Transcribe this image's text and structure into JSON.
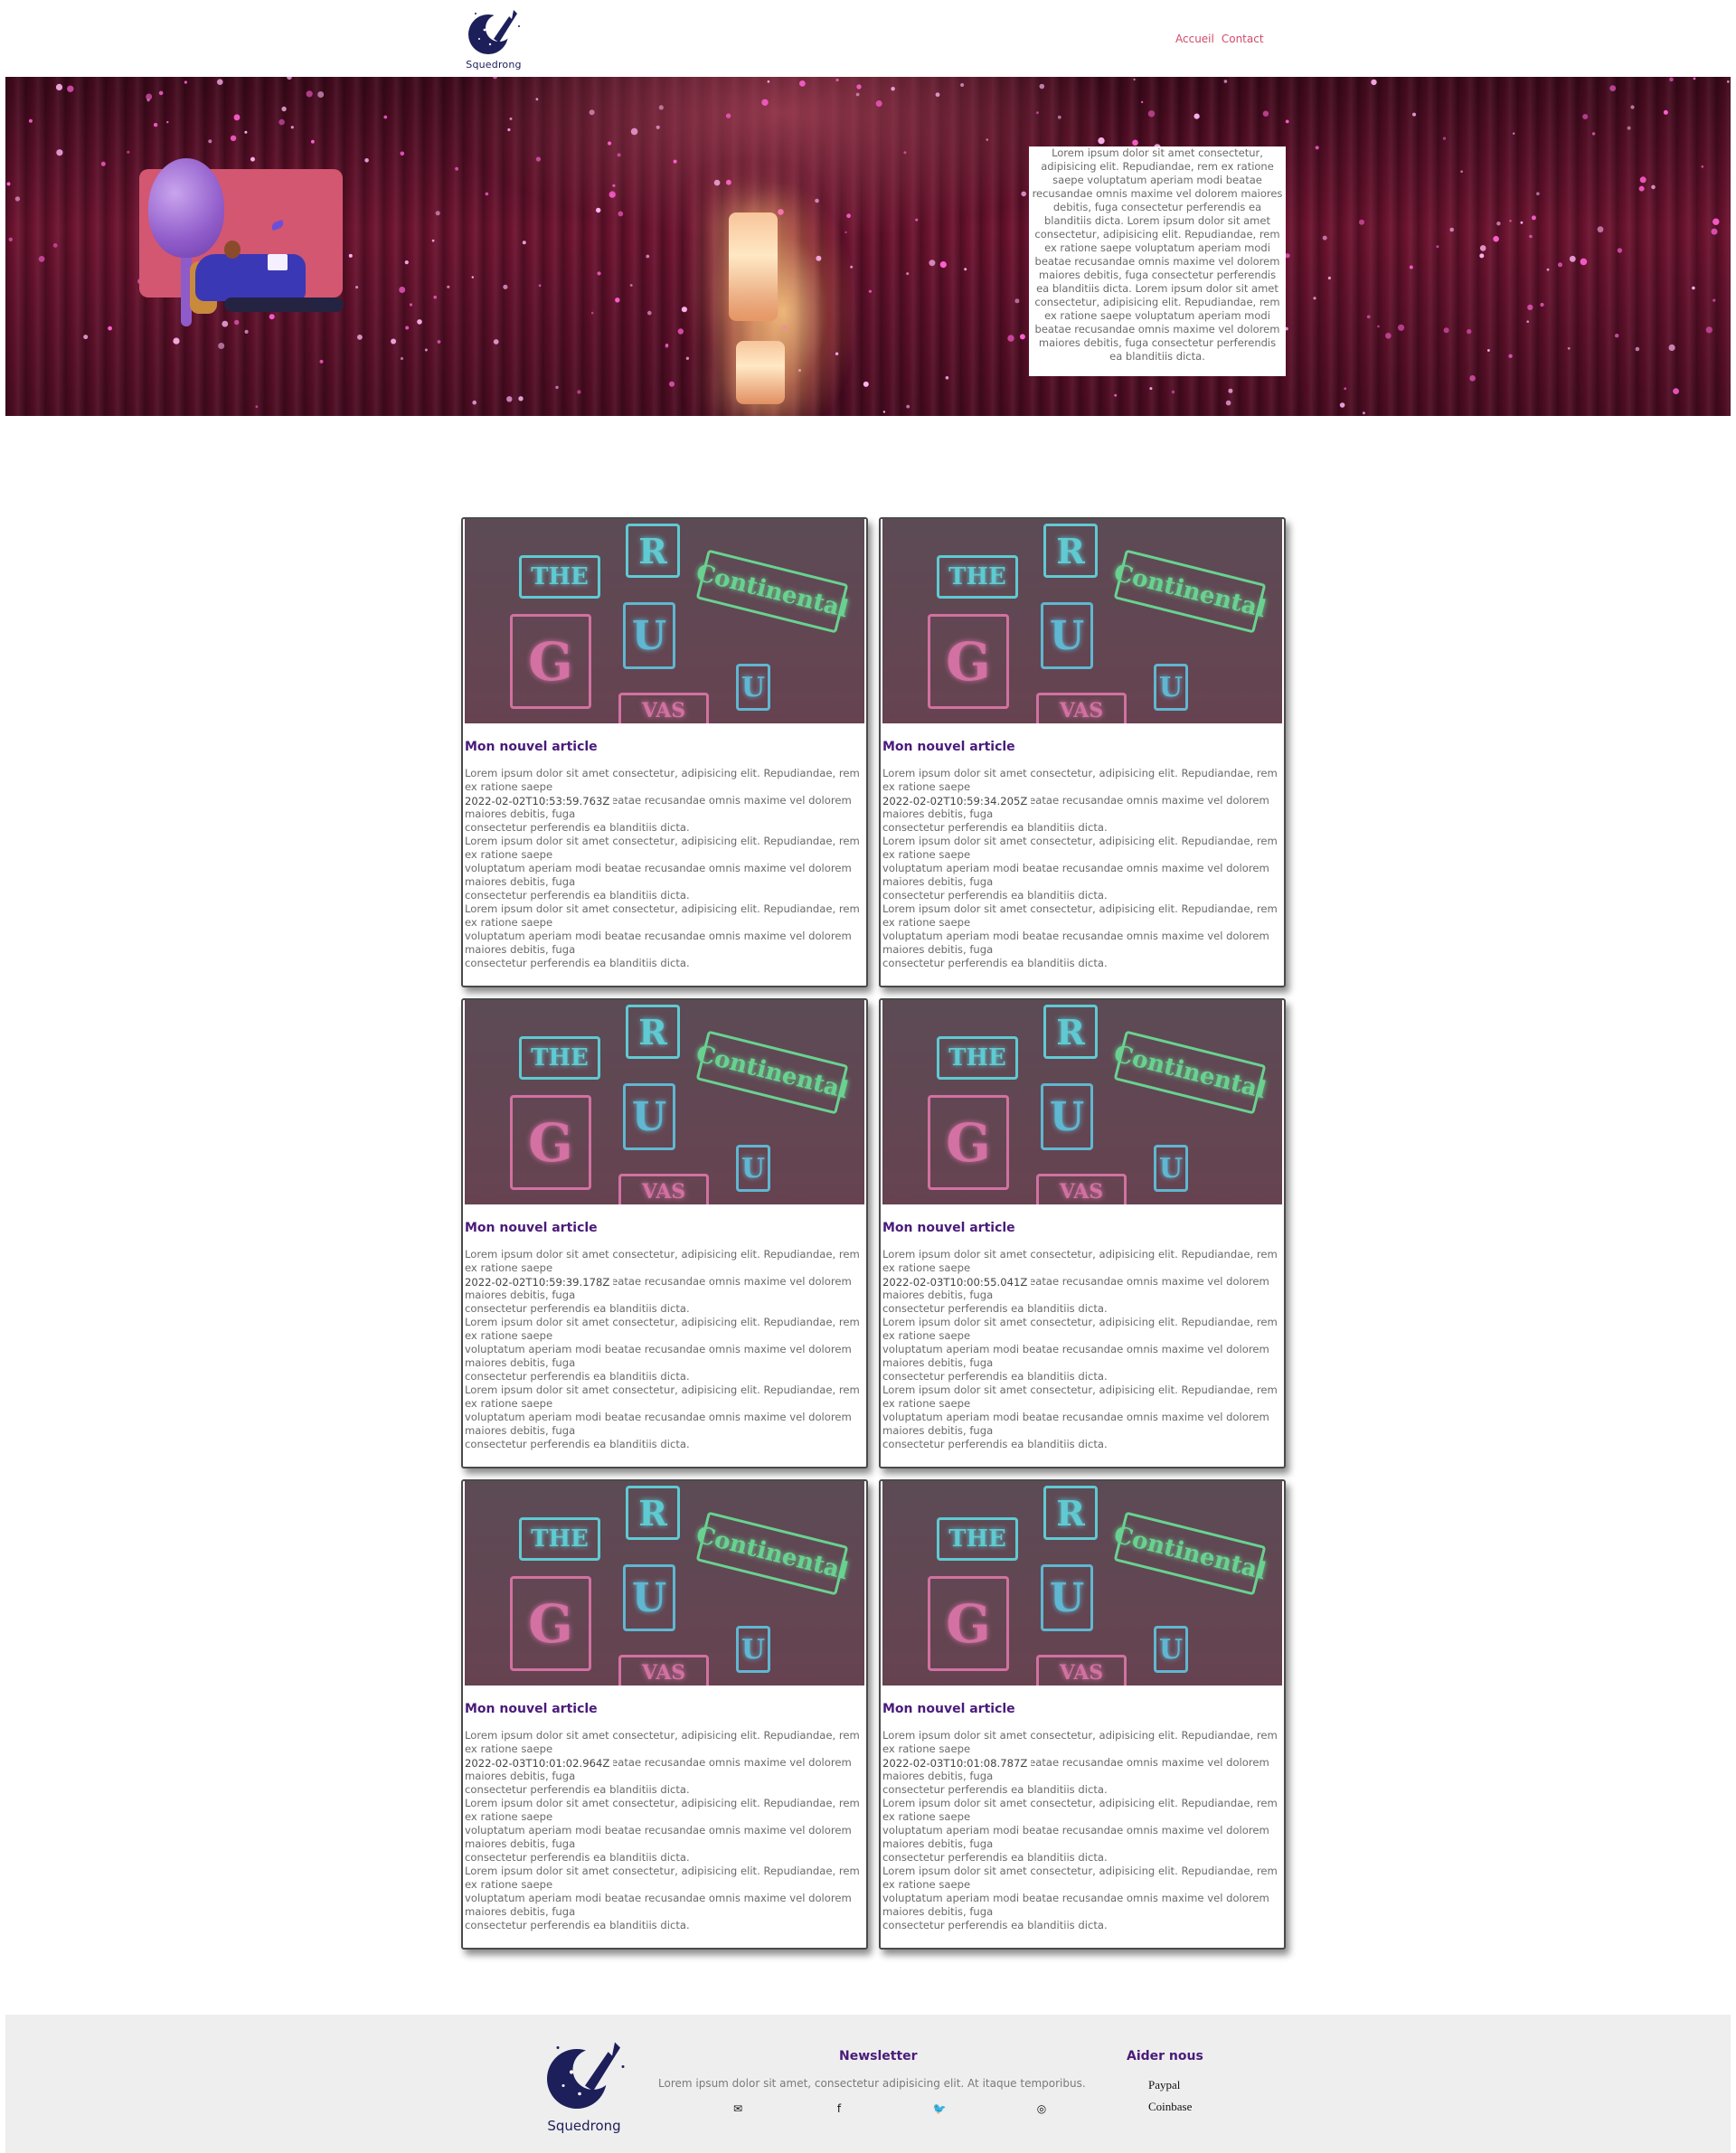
{
  "brand": {
    "name": "Squedrong",
    "accent": "#d24a6b",
    "title_color": "#4a1b7a"
  },
  "nav": {
    "items": [
      "Accueil",
      "Contact"
    ]
  },
  "hero": {
    "text": "Lorem ipsum dolor sit amet consectetur, adipisicing elit. Repudiandae, rem ex ratione saepe voluptatum aperiam modi beatae recusandae omnis maxime vel dolorem maiores debitis, fuga consectetur perferendis ea blanditiis dicta. Lorem ipsum dolor sit amet consectetur, adipisicing elit. Repudiandae, rem ex ratione saepe voluptatum aperiam modi beatae recusandae omnis maxime vel dolorem maiores debitis, fuga consectetur perferendis ea blanditiis dicta. Lorem ipsum dolor sit amet consectetur, adipisicing elit. Repudiandae, rem ex ratione saepe voluptatum aperiam modi beatae recusandae omnis maxime vel dolorem maiores debitis, fuga consectetur perferendis ea blanditiis dicta."
  },
  "articles": [
    {
      "title": "Mon nouvel article",
      "date": "2022-02-02T10:53:59.763Z"
    },
    {
      "title": "Mon nouvel article",
      "date": "2022-02-02T10:59:34.205Z"
    },
    {
      "title": "Mon nouvel article",
      "date": "2022-02-02T10:59:39.178Z"
    },
    {
      "title": "Mon nouvel article",
      "date": "2022-02-03T10:00:55.041Z"
    },
    {
      "title": "Mon nouvel article",
      "date": "2022-02-03T10:01:02.964Z"
    },
    {
      "title": "Mon nouvel article",
      "date": "2022-02-03T10:01:08.787Z"
    }
  ],
  "article_body": "Lorem ipsum dolor sit amet consectetur, adipisicing elit. Repudiandae, rem ex ratione saepe\nvoluptatum aperiam modi beatae recusandae omnis maxime vel dolorem maiores debitis, fuga\nconsectetur perferendis ea blanditiis dicta.\nLorem ipsum dolor sit amet consectetur, adipisicing elit. Repudiandae, rem ex ratione saepe\nvoluptatum aperiam modi beatae recusandae omnis maxime vel dolorem maiores debitis, fuga\nconsectetur perferendis ea blanditiis dicta.\nLorem ipsum dolor sit amet consectetur, adipisicing elit. Repudiandae, rem ex ratione saepe\nvoluptatum aperiam modi beatae recusandae omnis maxime vel dolorem maiores debitis, fuga\nconsectetur perferendis ea blanditiis dicta.",
  "image_signs": [
    "THE",
    "R",
    "G",
    "U",
    "Continental",
    "VAS",
    "U"
  ],
  "footer": {
    "logo_text": "Squedrong",
    "newsletter_title": "Newsletter",
    "newsletter_text": "Lorem ipsum dolor sit amet, consectetur adipisicing elit. At itaque temporibus.",
    "social_icons": [
      "envelope-icon",
      "facebook-icon",
      "twitter-icon",
      "instagram-icon"
    ],
    "social_glyphs": [
      "✉",
      "f",
      "🐦",
      "◎"
    ],
    "help_title": "Aider nous",
    "help_links": [
      "Paypal",
      "Coinbase"
    ]
  }
}
